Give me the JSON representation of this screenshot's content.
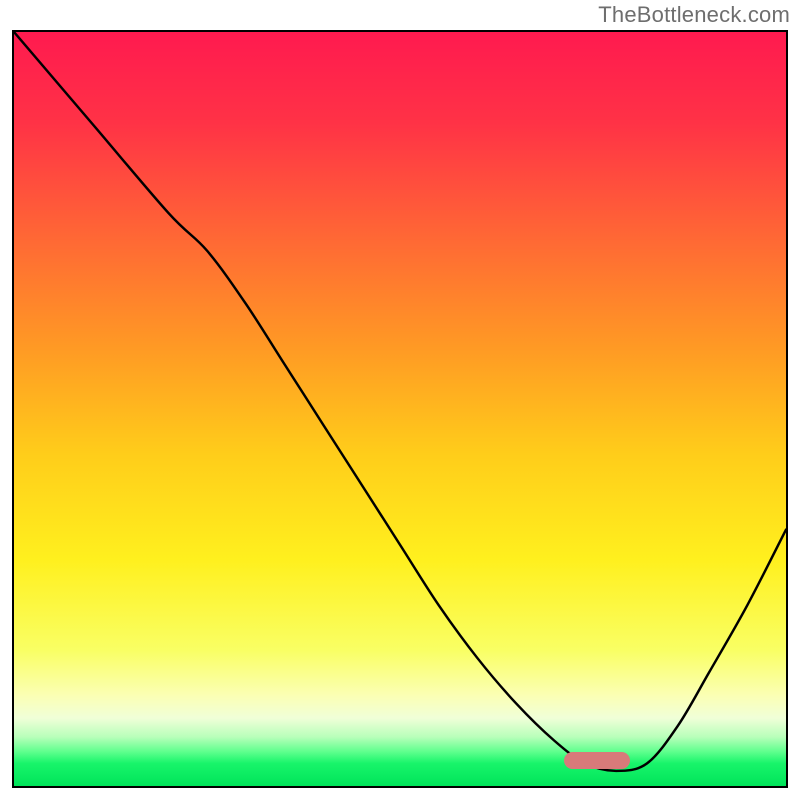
{
  "watermark": {
    "text": "TheBottleneck.com"
  },
  "frame": {
    "border_color": "#000000",
    "border_width_px": 2,
    "bg": "#ffffff"
  },
  "gradient": {
    "stops": [
      {
        "pct": 0,
        "color": "#ff1a4f"
      },
      {
        "pct": 12,
        "color": "#ff3246"
      },
      {
        "pct": 28,
        "color": "#ff6a34"
      },
      {
        "pct": 42,
        "color": "#ff9a24"
      },
      {
        "pct": 56,
        "color": "#ffcd1a"
      },
      {
        "pct": 70,
        "color": "#fff01e"
      },
      {
        "pct": 82,
        "color": "#f9ff64"
      },
      {
        "pct": 88,
        "color": "#fbffb4"
      },
      {
        "pct": 91,
        "color": "#f0ffd8"
      },
      {
        "pct": 93.5,
        "color": "#b8ffba"
      },
      {
        "pct": 95.5,
        "color": "#5cff8c"
      },
      {
        "pct": 97,
        "color": "#18f46a"
      },
      {
        "pct": 100,
        "color": "#00e45a"
      }
    ]
  },
  "marker": {
    "color": "#d87a7a",
    "x_norm": 0.755,
    "y_norm": 0.966,
    "w_norm": 0.085,
    "h_norm": 0.022
  },
  "chart_data": {
    "type": "line",
    "title": "",
    "xlabel": "",
    "ylabel": "",
    "xlim": [
      0,
      100
    ],
    "ylim": [
      0,
      100
    ],
    "grid": false,
    "legend": false,
    "annotations": [
      {
        "kind": "marker",
        "shape": "pill",
        "x": 75.5,
        "y": 3.4,
        "color": "#d87a7a"
      }
    ],
    "series": [
      {
        "name": "curve",
        "color": "#000000",
        "x": [
          0,
          10,
          20,
          25,
          30,
          35,
          40,
          45,
          50,
          55,
          60,
          65,
          70,
          74,
          78,
          82,
          86,
          90,
          95,
          100
        ],
        "y": [
          100,
          88,
          76,
          71,
          64,
          56,
          48,
          40,
          32,
          24,
          17,
          11,
          6,
          3,
          2,
          3,
          8,
          15,
          24,
          34
        ]
      }
    ],
    "optimum": {
      "x": 77,
      "y": 2
    }
  }
}
